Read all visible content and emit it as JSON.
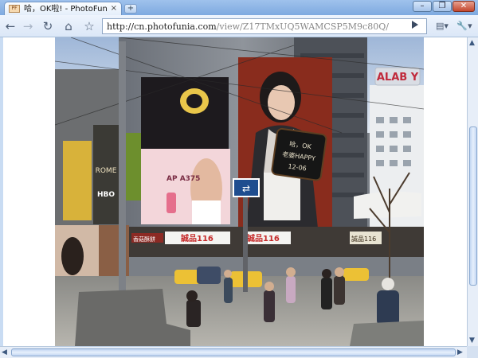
{
  "browser": {
    "tab_title": "哈，OK啦! - PhotoFunia",
    "tab_close": "×",
    "new_tab": "+",
    "favicon_text": "PF",
    "window_controls": {
      "minimize": "–",
      "maximize": "❐",
      "close": "✕"
    }
  },
  "toolbar": {
    "back": "←",
    "forward": "→",
    "reload": "↻",
    "home": "⌂",
    "star": "☆",
    "page_menu": "▤▾",
    "wrench_menu": "🔧▾",
    "url_host": "http://cn.photofunia.com",
    "url_path": "/view/Z17TMxUQ5WAMCSP5M9c80Q/"
  },
  "photo": {
    "signs": {
      "top_right": "ALAB Y",
      "left_banner_line1": "ROME",
      "left_banner_line2": "HBO",
      "phone_ad_text": "AP A375",
      "store_left": "誠品116",
      "store_right": "誠品116",
      "store_center": "誠品116",
      "station_logo": "⇄",
      "board_text_1": "哈，OK",
      "board_text_2": "老婆HAPPY",
      "board_text_3": "12-06",
      "small_sign_1": "香菇酥餅"
    }
  },
  "scrollbars": {
    "up": "▲",
    "down": "▼",
    "left": "◀",
    "right": "▶"
  },
  "colors": {
    "titlebar": "#8fb6e8",
    "toolbar": "#e6eefa",
    "page_bg": "#ffffff"
  }
}
